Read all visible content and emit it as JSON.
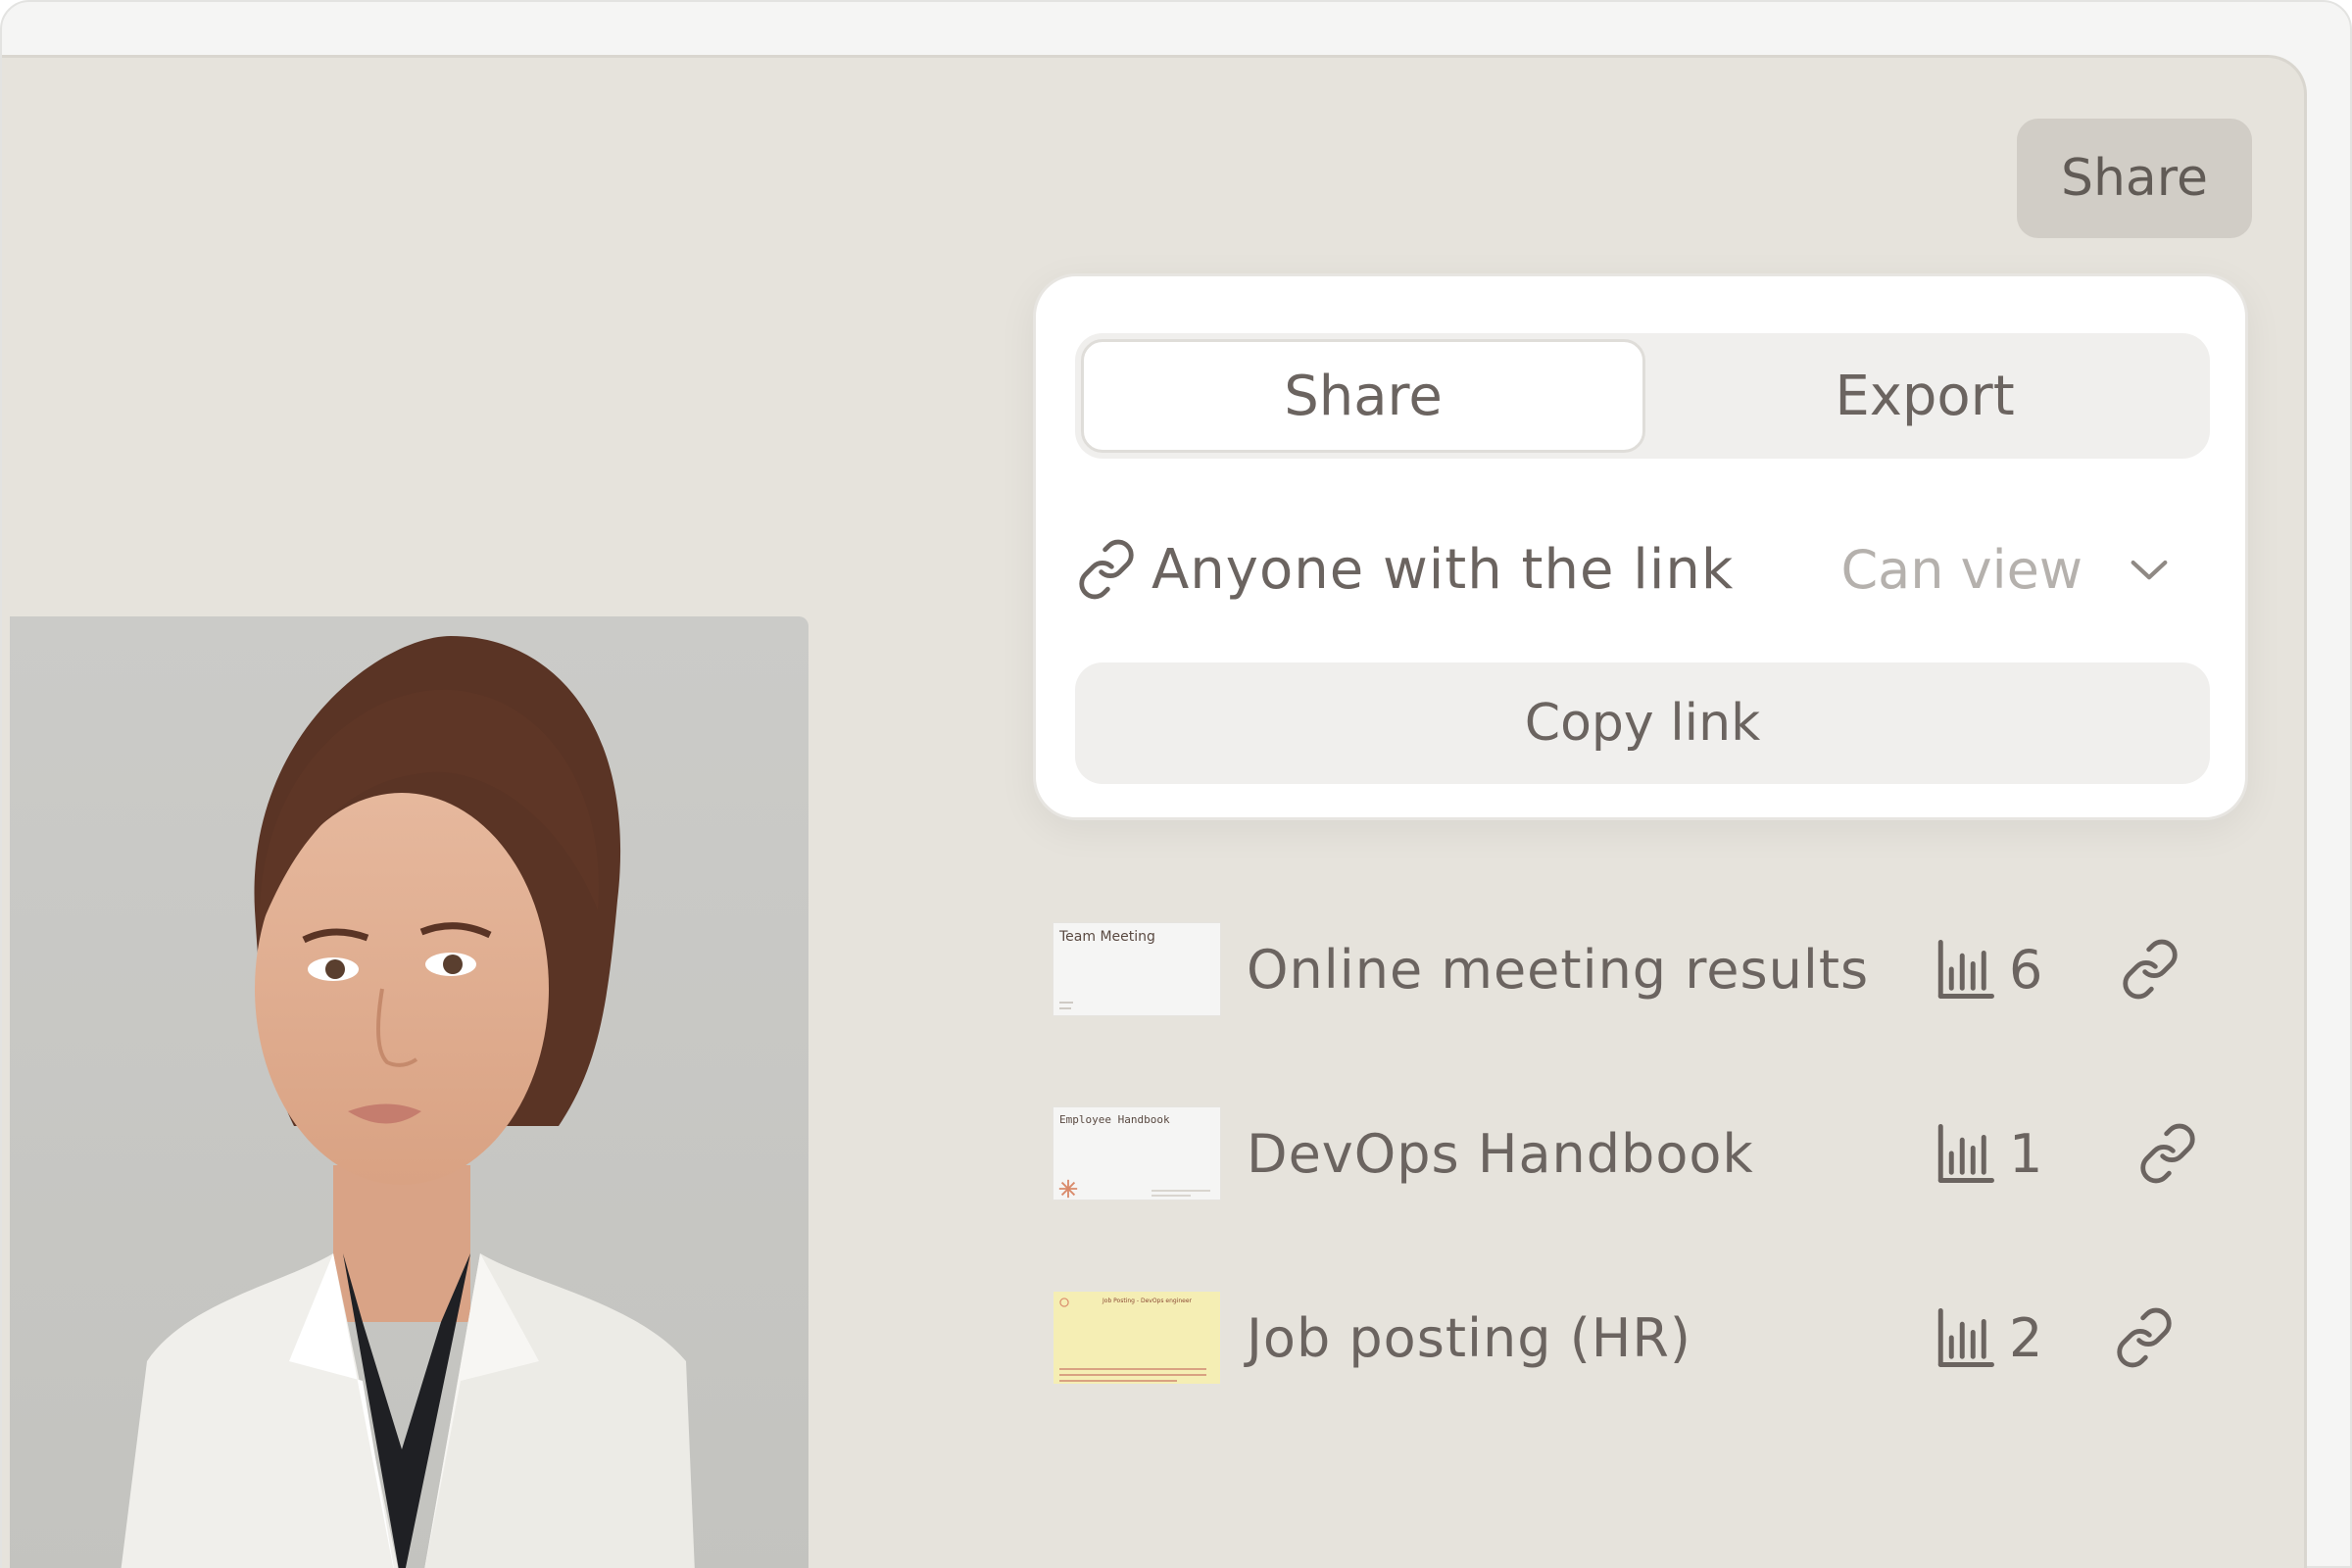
{
  "toolbar": {
    "share_label": "Share"
  },
  "share_panel": {
    "tabs": [
      {
        "label": "Share",
        "active": true
      },
      {
        "label": "Export",
        "active": false
      }
    ],
    "access_label": "Anyone with the link",
    "permission": "Can view",
    "copy_link_label": "Copy link"
  },
  "documents": [
    {
      "thumbnail_title": "Team Meeting",
      "title": "Online meeting results",
      "count": "6"
    },
    {
      "thumbnail_title": "Employee Handbook",
      "title": "DevOps Handbook",
      "count": "1"
    },
    {
      "thumbnail_title": "Job Posting - DevOps engineer",
      "title": "Job posting (HR)",
      "count": "2"
    }
  ],
  "colors": {
    "canvas": "#e6e3dc",
    "panel": "#ffffff",
    "text": "#6b6460",
    "muted": "#b5b1ad",
    "share_button": "#d1cdc6"
  },
  "icons": [
    "link-icon",
    "chevron-down-icon",
    "bar-chart-icon"
  ]
}
